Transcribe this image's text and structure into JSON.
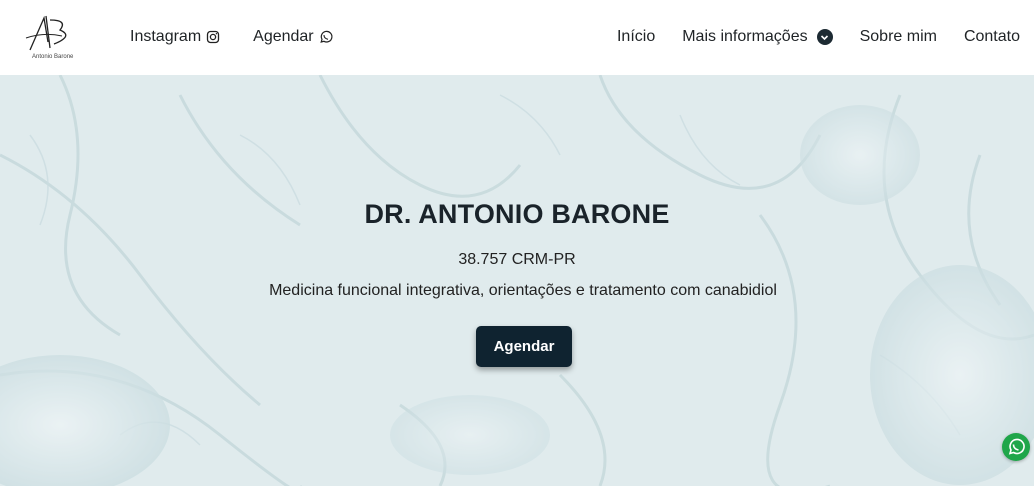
{
  "brand": {
    "logo_initials": "AB",
    "logo_name": "Antonio Barone"
  },
  "nav": {
    "left": [
      {
        "label": "Instagram",
        "icon": "instagram-icon"
      },
      {
        "label": "Agendar",
        "icon": "whatsapp-icon"
      }
    ],
    "right": [
      {
        "label": "Início"
      },
      {
        "label": "Mais informações",
        "icon": "chevron-down-icon"
      },
      {
        "label": "Sobre mim"
      },
      {
        "label": "Contato"
      }
    ]
  },
  "hero": {
    "title": "DR. ANTONIO BARONE",
    "crm": "38.757 CRM-PR",
    "description": "Medicina funcional integrativa, orientações e tratamento com canabidiol",
    "cta_label": "Agendar"
  },
  "floating": {
    "icon": "whatsapp-icon"
  },
  "colors": {
    "button_bg": "#0f2330",
    "whatsapp_green": "#1fa64a",
    "hero_tint": "#dbe8ea"
  }
}
